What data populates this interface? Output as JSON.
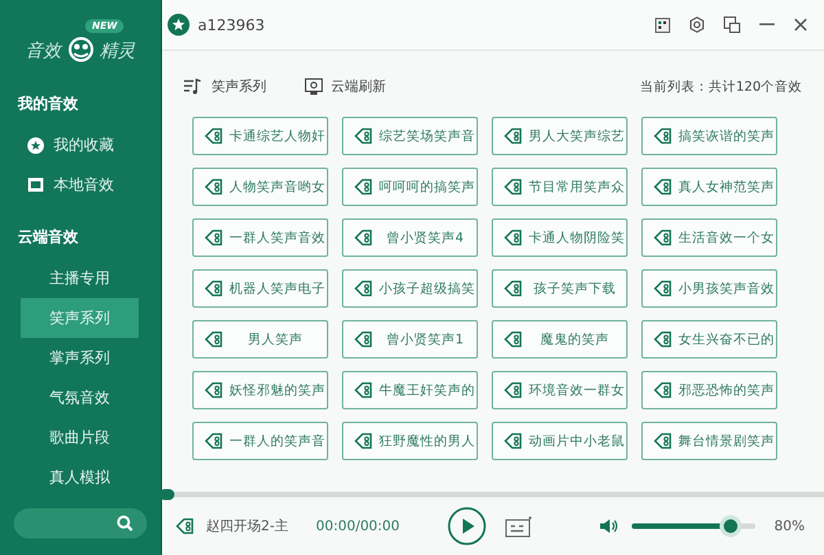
{
  "logo": {
    "left": "音效",
    "right": "精灵",
    "badge": "NEW"
  },
  "sidebar": {
    "sections": [
      {
        "title": "我的音效",
        "items": [
          {
            "label": "我的收藏",
            "kind": "favorites",
            "selected": false
          },
          {
            "label": "本地音效",
            "kind": "local",
            "selected": false
          }
        ]
      },
      {
        "title": "云端音效",
        "items": [
          {
            "label": "主播专用",
            "selected": false
          },
          {
            "label": "笑声系列",
            "selected": true
          },
          {
            "label": "掌声系列",
            "selected": false
          },
          {
            "label": "气氛音效",
            "selected": false
          },
          {
            "label": "歌曲片段",
            "selected": false
          },
          {
            "label": "真人模拟",
            "selected": false
          }
        ]
      }
    ]
  },
  "user": {
    "name": "a123963"
  },
  "toolbar": {
    "category": "笑声系列",
    "refresh": "云端刷新",
    "summary": "当前列表：共计120个音效"
  },
  "sounds": [
    "卡通综艺人物奸",
    "综艺笑场笑声音",
    "男人大笑声综艺",
    "搞笑诙谐的笑声",
    "人物笑声音哟女",
    "呵呵呵的搞笑声",
    "节目常用笑声众",
    "真人女神范笑声",
    "一群人笑声音效",
    "曾小贤笑声4",
    "卡通人物阴险笑",
    "生活音效一个女",
    "机器人笑声电子",
    "小孩子超级搞笑",
    "孩子笑声下载",
    "小男孩笑声音效",
    "男人笑声",
    "曾小贤笑声1",
    "魔鬼的笑声",
    "女生兴奋不已的",
    "妖怪邪魅的笑声",
    "牛魔王奸笑声的",
    "环境音效一群女",
    "邪恶恐怖的笑声",
    "一群人的笑声音",
    "狂野魔性的男人",
    "动画片中小老鼠",
    "舞台情景剧笑声"
  ],
  "player": {
    "progress": {
      "level": 0
    },
    "track": "赵四开场2-主",
    "time": "00:00/00:00",
    "volume": {
      "level": 0.8
    },
    "volume_reading": "80%"
  }
}
